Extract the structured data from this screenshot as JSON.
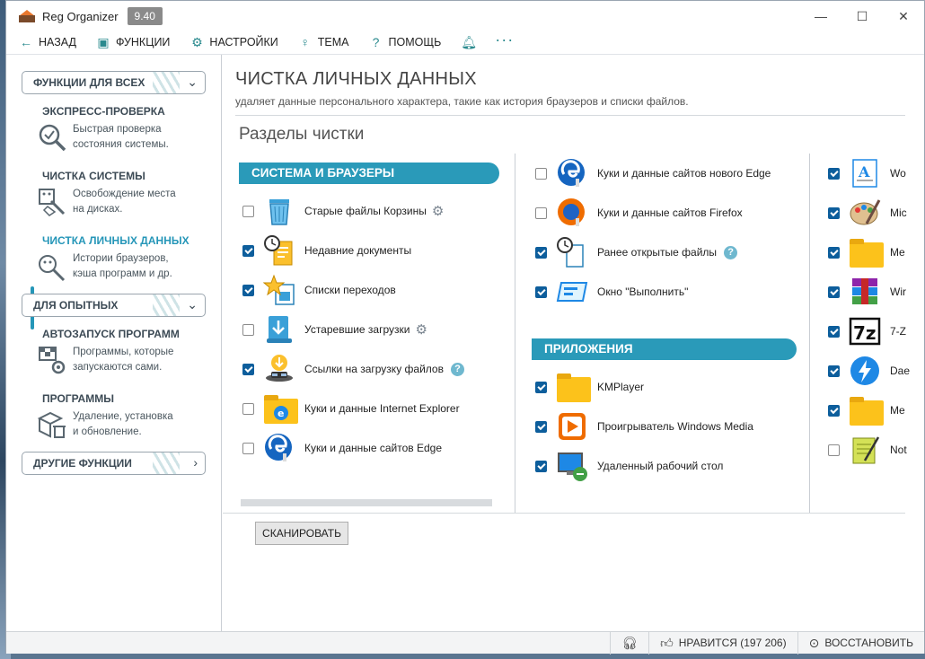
{
  "window": {
    "title": "Reg Organizer",
    "version": "9.40",
    "controls": {
      "minimize": "—",
      "maximize": "☐",
      "close": "✕"
    }
  },
  "menu": {
    "back": "НАЗАД",
    "functions": "ФУНКЦИИ",
    "settings": "НАСТРОЙКИ",
    "theme": "ТЕМА",
    "help": "ПОМОЩЬ"
  },
  "sidebar": {
    "groups": {
      "all": "ФУНКЦИИ ДЛЯ ВСЕХ",
      "advanced": "ДЛЯ ОПЫТНЫХ",
      "other": "ДРУГИЕ ФУНКЦИИ"
    },
    "items": [
      {
        "title": "ЭКСПРЕСС-ПРОВЕРКА",
        "desc1": "Быстрая проверка",
        "desc2": "состояния системы."
      },
      {
        "title": "ЧИСТКА СИСТЕМЫ",
        "desc1": "Освобождение места",
        "desc2": "на дисках."
      },
      {
        "title": "ЧИСТКА ЛИЧНЫХ ДАННЫХ",
        "desc1": "Истории браузеров,",
        "desc2": "кэша программ и др."
      },
      {
        "title": "АВТОЗАПУСК ПРОГРАММ",
        "desc1": "Программы, которые",
        "desc2": "запускаются сами."
      },
      {
        "title": "ПРОГРАММЫ",
        "desc1": "Удаление, установка",
        "desc2": "и обновление."
      }
    ]
  },
  "main": {
    "title": "ЧИСТКА ЛИЧНЫХ ДАННЫХ",
    "subtitle": "удаляет данные персонального характера, такие как история браузеров и списки файлов.",
    "section_title": "Разделы чистки",
    "cat_system": "СИСТЕМА И БРАУЗЕРЫ",
    "cat_apps": "ПРИЛОЖЕНИЯ",
    "col1": [
      {
        "label": "Старые файлы Корзины",
        "checked": false
      },
      {
        "label": "Недавние документы",
        "checked": true
      },
      {
        "label": "Списки переходов",
        "checked": true
      },
      {
        "label": "Устаревшие загрузки",
        "checked": false
      },
      {
        "label": "Ссылки на загрузку файлов",
        "checked": true
      },
      {
        "label": "Куки и данные Internet Explorer",
        "checked": false
      },
      {
        "label": "Куки и данные сайтов Edge",
        "checked": false
      }
    ],
    "col2": [
      {
        "label": "Куки и данные сайтов нового Edge",
        "checked": false
      },
      {
        "label": "Куки и данные сайтов Firefox",
        "checked": false
      },
      {
        "label": "Ранее открытые файлы",
        "checked": true
      },
      {
        "label": "Окно \"Выполнить\"",
        "checked": true
      }
    ],
    "col2_apps": [
      {
        "label": "KMPlayer",
        "checked": true
      },
      {
        "label": "Проигрыватель Windows Media",
        "checked": true
      },
      {
        "label": "Удаленный рабочий стол",
        "checked": true
      }
    ],
    "col3": [
      {
        "label": "Wo",
        "checked": true
      },
      {
        "label": "Mic",
        "checked": true
      },
      {
        "label": "Me",
        "checked": true
      },
      {
        "label": "Wir",
        "checked": true
      },
      {
        "label": "7-Z",
        "checked": true
      },
      {
        "label": "Dae",
        "checked": true
      },
      {
        "label": "Me",
        "checked": true
      },
      {
        "label": "Not",
        "checked": false
      }
    ],
    "scan_button": "СКАНИРОВАТЬ"
  },
  "status": {
    "like": "НРАВИТСЯ (197 206)",
    "restore": "ВОССТАНОВИТЬ"
  },
  "colors": {
    "accent": "#2a9ab9",
    "checkbox": "#0d5e9c"
  }
}
